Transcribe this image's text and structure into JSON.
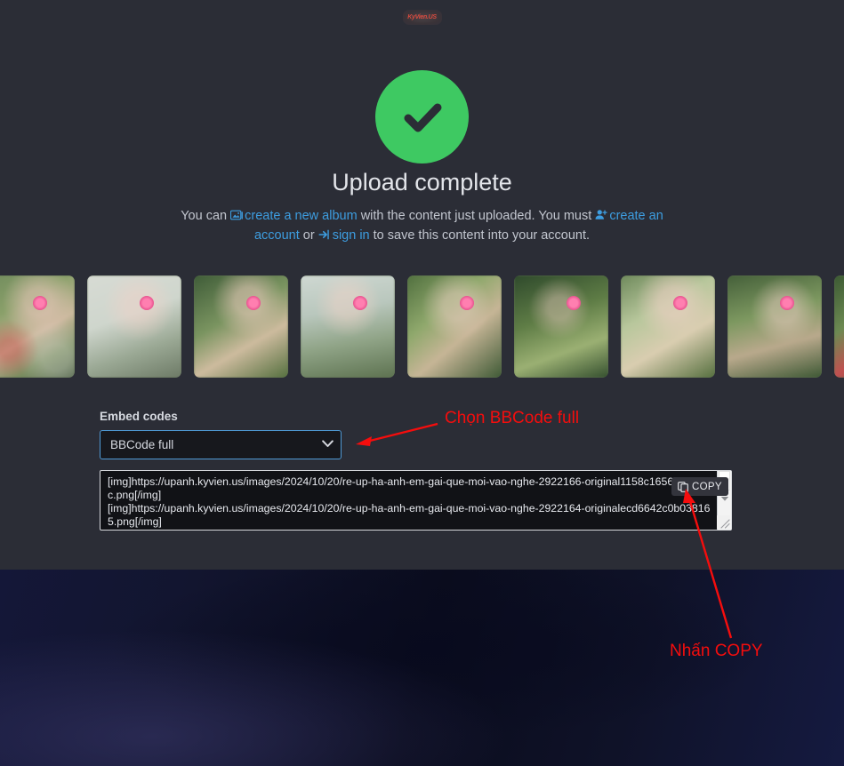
{
  "site": {
    "logo_text": "KyVien.US"
  },
  "status": {
    "icon": "check-circle-icon",
    "accent_color": "#3ec962",
    "title": "Upload complete"
  },
  "description": {
    "part1": "You can ",
    "link_album": "create a new album",
    "part2": " with the content just uploaded. You must ",
    "link_create_account": "create an account",
    "part3": " or ",
    "link_sign_in": "sign in",
    "part4": " to save this content into your account.",
    "link_color": "#3d9de0"
  },
  "thumbnails": {
    "count": 9,
    "items": [
      {
        "label": "uploaded-image-1"
      },
      {
        "label": "uploaded-image-2"
      },
      {
        "label": "uploaded-image-3"
      },
      {
        "label": "uploaded-image-4"
      },
      {
        "label": "uploaded-image-5"
      },
      {
        "label": "uploaded-image-6"
      },
      {
        "label": "uploaded-image-7"
      },
      {
        "label": "uploaded-image-8"
      },
      {
        "label": "uploaded-image-9"
      }
    ]
  },
  "embed": {
    "label": "Embed codes",
    "selected_option": "BBCode full",
    "options": [
      "BBCode full"
    ],
    "border_color": "#4f9ad6",
    "textarea_value": "[img]https://upanh.kyvien.us/images/2024/10/20/re-up-ha-anh-em-gai-que-moi-vao-nghe-2922166-original1158c165601674fc.png[/img]\n[img]https://upanh.kyvien.us/images/2024/10/20/re-up-ha-anh-em-gai-que-moi-vao-nghe-2922164-originalecd6642c0b038165.png[/img]",
    "copy_button_label": "COPY",
    "copy_button_icon": "copy-icon"
  },
  "annotations": {
    "color": "#f50d0d",
    "select_hint": "Chọn BBCode full",
    "copy_hint": "Nhấn COPY"
  }
}
